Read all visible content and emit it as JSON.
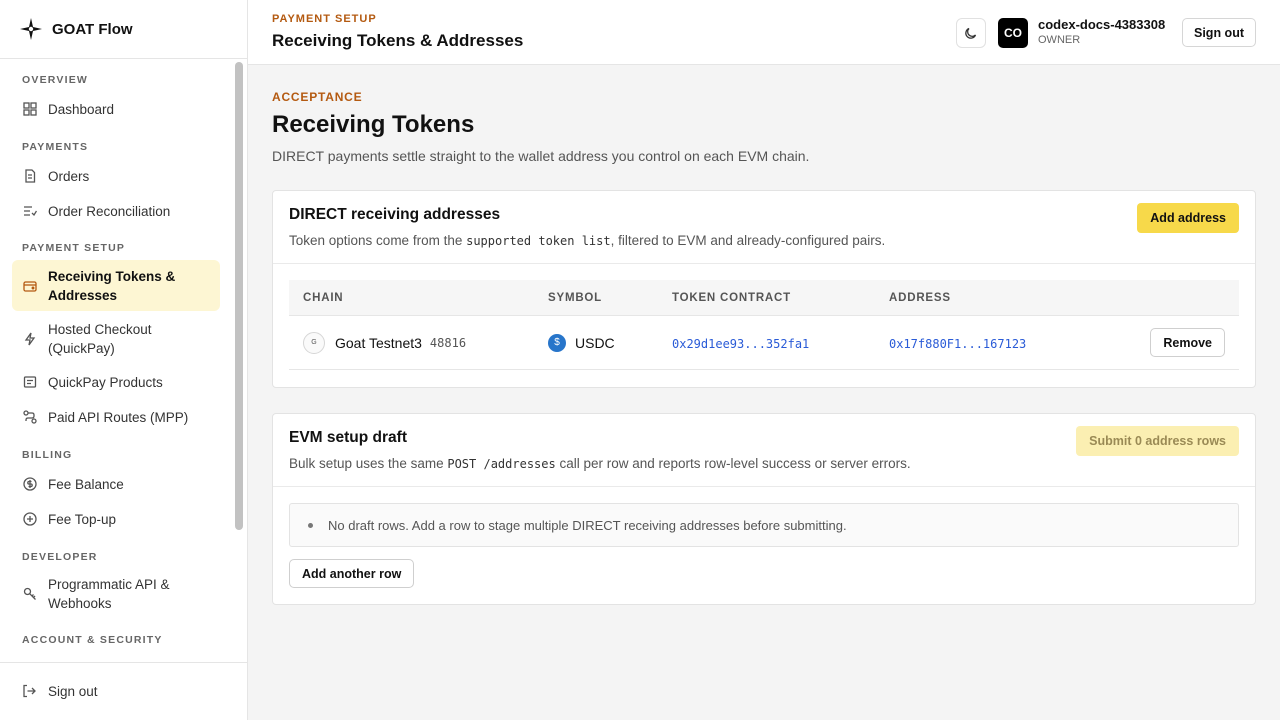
{
  "brand": {
    "name": "GOAT Flow"
  },
  "sidebar": {
    "sections": [
      {
        "title": "OVERVIEW",
        "items": [
          {
            "label": "Dashboard",
            "icon": "grid-icon"
          }
        ]
      },
      {
        "title": "PAYMENTS",
        "items": [
          {
            "label": "Orders",
            "icon": "document-icon"
          },
          {
            "label": "Order Reconciliation",
            "icon": "list-check-icon"
          }
        ]
      },
      {
        "title": "PAYMENT SETUP",
        "items": [
          {
            "label": "Receiving Tokens & Addresses",
            "icon": "wallet-icon",
            "active": true
          },
          {
            "label": "Hosted Checkout (QuickPay)",
            "icon": "lightning-icon"
          },
          {
            "label": "QuickPay Products",
            "icon": "receipt-icon"
          },
          {
            "label": "Paid API Routes (MPP)",
            "icon": "route-icon"
          }
        ]
      },
      {
        "title": "BILLING",
        "items": [
          {
            "label": "Fee Balance",
            "icon": "coin-icon"
          },
          {
            "label": "Fee Top-up",
            "icon": "plus-circle-icon"
          }
        ]
      },
      {
        "title": "DEVELOPER",
        "items": [
          {
            "label": "Programmatic API & Webhooks",
            "icon": "key-icon"
          }
        ]
      },
      {
        "title": "ACCOUNT & SECURITY",
        "items": []
      }
    ],
    "footer_label": "Sign out"
  },
  "header": {
    "eyebrow": "PAYMENT SETUP",
    "title": "Receiving Tokens & Addresses",
    "avatar_initials": "CO",
    "user_name": "codex-docs-4383308",
    "user_role": "OWNER",
    "signout_label": "Sign out"
  },
  "main": {
    "eyebrow": "ACCEPTANCE",
    "title": "Receiving Tokens",
    "subtitle": "DIRECT payments settle straight to the wallet address you control on each EVM chain.",
    "direct_card": {
      "title": "DIRECT receiving addresses",
      "desc_before": "Token options come from the ",
      "desc_code": "supported token list",
      "desc_after": ", filtered to EVM and already-configured pairs.",
      "add_button": "Add address",
      "columns": [
        "CHAIN",
        "SYMBOL",
        "TOKEN CONTRACT",
        "ADDRESS"
      ],
      "rows": [
        {
          "chain_icon": "G",
          "chain": "Goat Testnet3",
          "chain_id": "48816",
          "symbol": "USDC",
          "contract": "0x29d1ee93...352fa1",
          "address": "0x17f880F1...167123",
          "action": "Remove"
        }
      ]
    },
    "draft_card": {
      "title": "EVM setup draft",
      "desc_before": "Bulk setup uses the same ",
      "desc_code": "POST /addresses",
      "desc_after": " call per row and reports row-level success or server errors.",
      "submit_button": "Submit 0 address rows",
      "empty_message": "No draft rows. Add a row to stage multiple DIRECT receiving addresses before submitting.",
      "add_row_button": "Add another row"
    }
  },
  "colors": {
    "accent": "#f7d94a",
    "eyebrow": "#b45a11",
    "active_nav": "#fdf6d3",
    "link": "#2a5bd7"
  }
}
